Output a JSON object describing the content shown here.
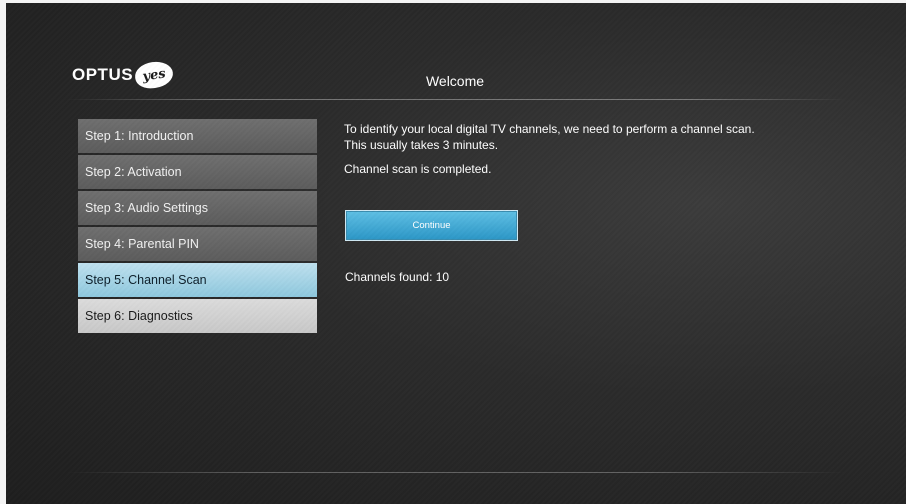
{
  "brand": {
    "name": "OPTUS",
    "badge": "yes"
  },
  "header": {
    "title": "Welcome"
  },
  "steps": [
    {
      "label": "Step 1: Introduction",
      "state": "done"
    },
    {
      "label": "Step 2: Activation",
      "state": "done"
    },
    {
      "label": "Step 3: Audio Settings",
      "state": "done"
    },
    {
      "label": "Step 4: Parental PIN",
      "state": "done"
    },
    {
      "label": "Step 5: Channel Scan",
      "state": "active"
    },
    {
      "label": "Step 6: Diagnostics",
      "state": "next"
    }
  ],
  "content": {
    "description": "To identify your local digital TV channels, we need to perform a channel scan. This usually takes 3 minutes.",
    "status": "Channel scan is completed.",
    "continue_label": "Continue",
    "channels_found": "Channels found: 10"
  },
  "colors": {
    "accent": "#2b96c6",
    "active_step": "#a9d6e8",
    "background": "#2b2b2b"
  }
}
